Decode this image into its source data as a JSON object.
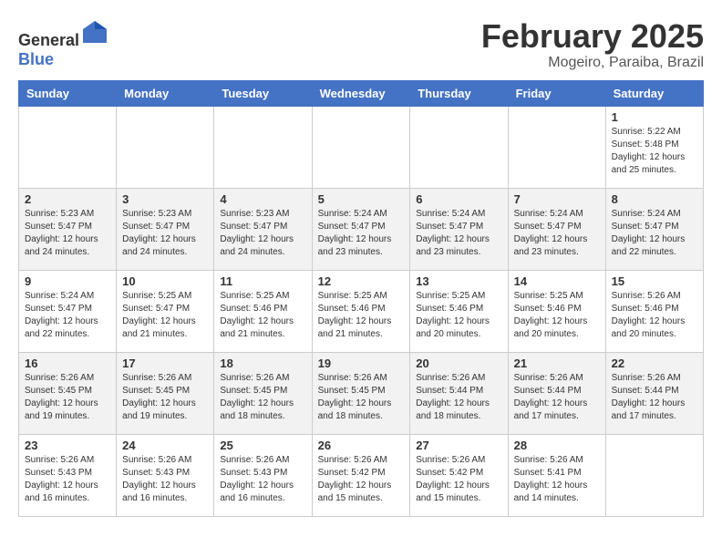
{
  "logo": {
    "text_general": "General",
    "text_blue": "Blue"
  },
  "title": {
    "month_year": "February 2025",
    "location": "Mogeiro, Paraiba, Brazil"
  },
  "days_of_week": [
    "Sunday",
    "Monday",
    "Tuesday",
    "Wednesday",
    "Thursday",
    "Friday",
    "Saturday"
  ],
  "weeks": [
    [
      {
        "day": "",
        "info": ""
      },
      {
        "day": "",
        "info": ""
      },
      {
        "day": "",
        "info": ""
      },
      {
        "day": "",
        "info": ""
      },
      {
        "day": "",
        "info": ""
      },
      {
        "day": "",
        "info": ""
      },
      {
        "day": "1",
        "info": "Sunrise: 5:22 AM\nSunset: 5:48 PM\nDaylight: 12 hours and 25 minutes."
      }
    ],
    [
      {
        "day": "2",
        "info": "Sunrise: 5:23 AM\nSunset: 5:47 PM\nDaylight: 12 hours and 24 minutes."
      },
      {
        "day": "3",
        "info": "Sunrise: 5:23 AM\nSunset: 5:47 PM\nDaylight: 12 hours and 24 minutes."
      },
      {
        "day": "4",
        "info": "Sunrise: 5:23 AM\nSunset: 5:47 PM\nDaylight: 12 hours and 24 minutes."
      },
      {
        "day": "5",
        "info": "Sunrise: 5:24 AM\nSunset: 5:47 PM\nDaylight: 12 hours and 23 minutes."
      },
      {
        "day": "6",
        "info": "Sunrise: 5:24 AM\nSunset: 5:47 PM\nDaylight: 12 hours and 23 minutes."
      },
      {
        "day": "7",
        "info": "Sunrise: 5:24 AM\nSunset: 5:47 PM\nDaylight: 12 hours and 23 minutes."
      },
      {
        "day": "8",
        "info": "Sunrise: 5:24 AM\nSunset: 5:47 PM\nDaylight: 12 hours and 22 minutes."
      }
    ],
    [
      {
        "day": "9",
        "info": "Sunrise: 5:24 AM\nSunset: 5:47 PM\nDaylight: 12 hours and 22 minutes."
      },
      {
        "day": "10",
        "info": "Sunrise: 5:25 AM\nSunset: 5:47 PM\nDaylight: 12 hours and 21 minutes."
      },
      {
        "day": "11",
        "info": "Sunrise: 5:25 AM\nSunset: 5:46 PM\nDaylight: 12 hours and 21 minutes."
      },
      {
        "day": "12",
        "info": "Sunrise: 5:25 AM\nSunset: 5:46 PM\nDaylight: 12 hours and 21 minutes."
      },
      {
        "day": "13",
        "info": "Sunrise: 5:25 AM\nSunset: 5:46 PM\nDaylight: 12 hours and 20 minutes."
      },
      {
        "day": "14",
        "info": "Sunrise: 5:25 AM\nSunset: 5:46 PM\nDaylight: 12 hours and 20 minutes."
      },
      {
        "day": "15",
        "info": "Sunrise: 5:26 AM\nSunset: 5:46 PM\nDaylight: 12 hours and 20 minutes."
      }
    ],
    [
      {
        "day": "16",
        "info": "Sunrise: 5:26 AM\nSunset: 5:45 PM\nDaylight: 12 hours and 19 minutes."
      },
      {
        "day": "17",
        "info": "Sunrise: 5:26 AM\nSunset: 5:45 PM\nDaylight: 12 hours and 19 minutes."
      },
      {
        "day": "18",
        "info": "Sunrise: 5:26 AM\nSunset: 5:45 PM\nDaylight: 12 hours and 18 minutes."
      },
      {
        "day": "19",
        "info": "Sunrise: 5:26 AM\nSunset: 5:45 PM\nDaylight: 12 hours and 18 minutes."
      },
      {
        "day": "20",
        "info": "Sunrise: 5:26 AM\nSunset: 5:44 PM\nDaylight: 12 hours and 18 minutes."
      },
      {
        "day": "21",
        "info": "Sunrise: 5:26 AM\nSunset: 5:44 PM\nDaylight: 12 hours and 17 minutes."
      },
      {
        "day": "22",
        "info": "Sunrise: 5:26 AM\nSunset: 5:44 PM\nDaylight: 12 hours and 17 minutes."
      }
    ],
    [
      {
        "day": "23",
        "info": "Sunrise: 5:26 AM\nSunset: 5:43 PM\nDaylight: 12 hours and 16 minutes."
      },
      {
        "day": "24",
        "info": "Sunrise: 5:26 AM\nSunset: 5:43 PM\nDaylight: 12 hours and 16 minutes."
      },
      {
        "day": "25",
        "info": "Sunrise: 5:26 AM\nSunset: 5:43 PM\nDaylight: 12 hours and 16 minutes."
      },
      {
        "day": "26",
        "info": "Sunrise: 5:26 AM\nSunset: 5:42 PM\nDaylight: 12 hours and 15 minutes."
      },
      {
        "day": "27",
        "info": "Sunrise: 5:26 AM\nSunset: 5:42 PM\nDaylight: 12 hours and 15 minutes."
      },
      {
        "day": "28",
        "info": "Sunrise: 5:26 AM\nSunset: 5:41 PM\nDaylight: 12 hours and 14 minutes."
      },
      {
        "day": "",
        "info": ""
      }
    ]
  ]
}
